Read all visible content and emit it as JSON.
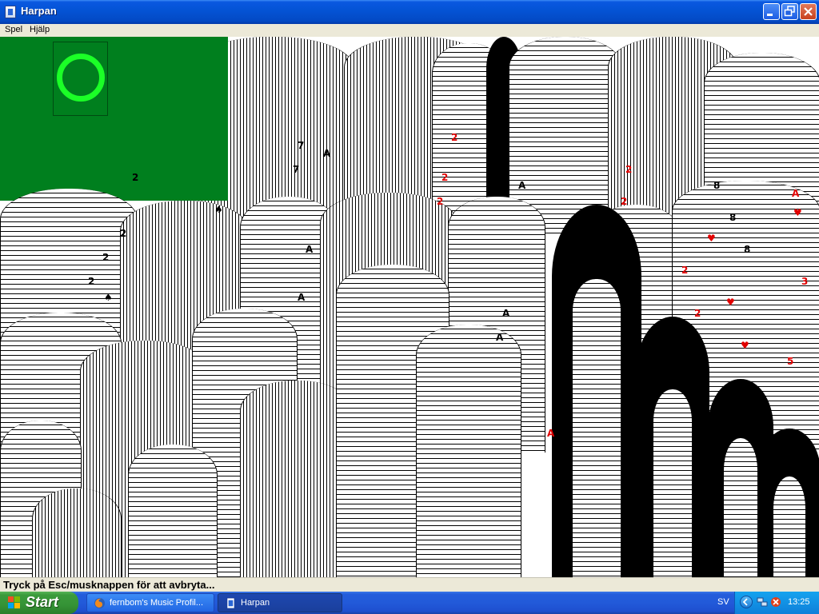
{
  "window": {
    "title": "Harpan"
  },
  "menu": {
    "items": [
      "Spel",
      "Hjälp"
    ]
  },
  "status": {
    "text": "Tryck på Esc/musknappen för att avbryta..."
  },
  "taskbar": {
    "start_label": "Start",
    "tasks": [
      {
        "label": "fernbom's Music Profil...",
        "icon": "firefox-icon"
      },
      {
        "label": "Harpan",
        "icon": "harpan-icon"
      }
    ],
    "language": "SV",
    "clock": "13:25"
  },
  "cards": {
    "ranks": [
      "A",
      "2",
      "3",
      "5",
      "7",
      "8"
    ],
    "suits": [
      "♠",
      "♥"
    ]
  },
  "colors": {
    "felt": "#007f1e",
    "deck_ring": "#1bff27",
    "card_red": "#e10000",
    "title_bar": "#0454d6"
  }
}
